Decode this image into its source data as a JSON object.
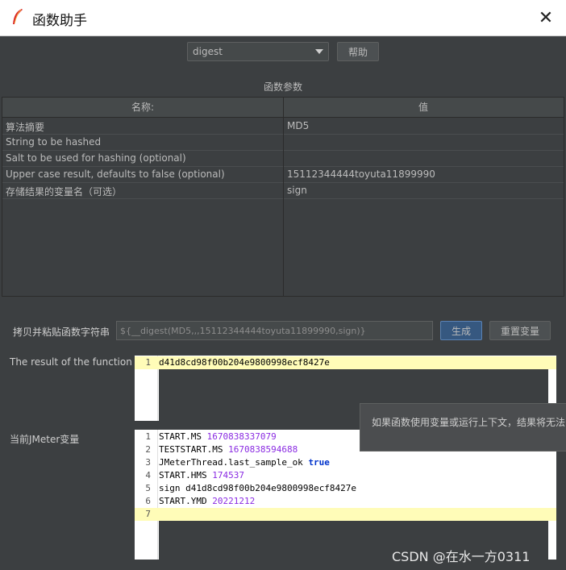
{
  "window": {
    "title": "函数助手",
    "close_icon": "close-icon"
  },
  "function_select": {
    "value": "digest"
  },
  "help_button": "帮助",
  "params_section_label": "函数参数",
  "params_table": {
    "headers": [
      "名称:",
      "值"
    ],
    "rows": [
      {
        "name": "算法摘要",
        "value": "MD5"
      },
      {
        "name": "String to be hashed",
        "value": ""
      },
      {
        "name": "Salt to be used for hashing (optional)",
        "value": ""
      },
      {
        "name": "Upper case result, defaults to false (optional)",
        "value": "15112344444toyuta11899990"
      },
      {
        "name": "存储结果的变量名（可选）",
        "value": "sign"
      }
    ]
  },
  "copy_label": "拷贝并粘贴函数字符串",
  "function_string": "${__digest(MD5,,,15112344444toyuta11899990,sign)}",
  "generate_button": "生成",
  "reset_button": "重置变量",
  "result_label": "The result of the function is",
  "result_lines": [
    "d41d8cd98f00b204e9800998ecf8427e"
  ],
  "vars_label": "当前JMeter变量",
  "vars_lines": [
    {
      "n": "1",
      "key": "START.MS ",
      "val": "1670838337079"
    },
    {
      "n": "2",
      "key": "TESTSTART.MS ",
      "val": "1670838594688"
    },
    {
      "n": "3",
      "key": "JMeterThread.last_sample_ok ",
      "val": "true"
    },
    {
      "n": "4",
      "key": "START.HMS ",
      "val": "174537"
    },
    {
      "n": "5",
      "key": "sign ",
      "val": "d41d8cd98f00b204e9800998ecf8427e"
    },
    {
      "n": "6",
      "key": "START.YMD ",
      "val": "20221212"
    },
    {
      "n": "7",
      "key": "",
      "val": ""
    }
  ],
  "tooltip": "如果函数使用变量或运行上下文，结果将无法",
  "watermark": "CSDN @在水一方0311"
}
